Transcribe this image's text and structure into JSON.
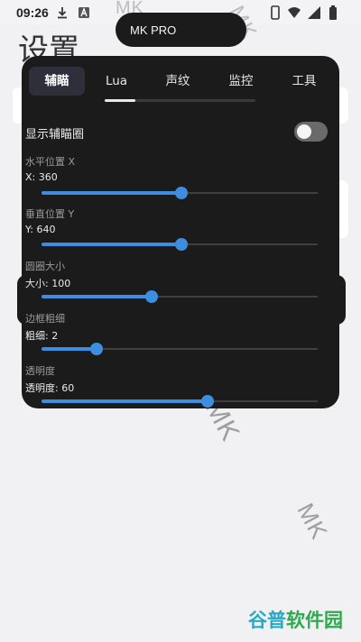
{
  "status_bar": {
    "time": "09:26",
    "icons": [
      "download-icon",
      "notification-a-icon",
      "phone-icon",
      "wifi-icon",
      "cell-signal-icon",
      "battery-icon"
    ]
  },
  "page": {
    "title": "设置"
  },
  "overlay": {
    "name": "MK PRO"
  },
  "watermark": {
    "text": "MK"
  },
  "tabs": [
    {
      "label": "辅瞄",
      "active": true
    },
    {
      "label": "Lua",
      "active": false
    },
    {
      "label": "声纹",
      "active": false
    },
    {
      "label": "监控",
      "active": false
    },
    {
      "label": "工具",
      "active": false
    }
  ],
  "settings": {
    "show_circle": {
      "label": "显示辅瞄圈",
      "enabled": false
    },
    "sliders": [
      {
        "id": "x",
        "title": "水平位置 X",
        "value_label": "X: 360",
        "fraction": 0.505
      },
      {
        "id": "y",
        "title": "垂直位置 Y",
        "value_label": "Y: 640",
        "fraction": 0.505
      },
      {
        "id": "size",
        "title": "圆圈大小",
        "value_label": "大小: 100",
        "fraction": 0.4
      },
      {
        "id": "border",
        "title": "边框粗细",
        "value_label": "粗细: 2",
        "fraction": 0.2
      },
      {
        "id": "opacity",
        "title": "透明度",
        "value_label": "透明度: 60",
        "fraction": 0.6
      }
    ]
  },
  "colors": {
    "accent": "#3d8ee0",
    "panel": "#1b1b1b"
  },
  "brand_logo": {
    "part1": "谷普",
    "part2": "软件园"
  }
}
